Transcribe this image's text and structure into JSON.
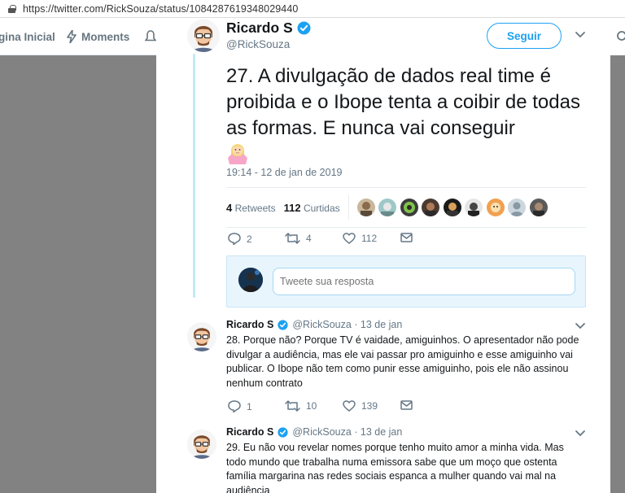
{
  "browser": {
    "url": "https://twitter.com/RickSouza/status/1084287619348029440"
  },
  "nav": {
    "home": "gina Inicial",
    "moments": "Moments"
  },
  "tweet": {
    "name": "Ricardo S",
    "handle": "@RickSouza",
    "follow_label": "Seguir",
    "text": "27. A divulgação de dados real time é proibida e o Ibope tenta a coibir de todas as formas. E nunca vai conseguir",
    "emoji": "woman-shrugging",
    "timestamp": "19:14 - 12 de jan de 2019",
    "retweets_count": "4",
    "retweets_label": "Retweets",
    "likes_count": "112",
    "likes_label": "Curtidas",
    "reply_count": "2",
    "retweet_action_count": "4",
    "like_action_count": "112",
    "reply_placeholder": "Tweete sua resposta"
  },
  "replies": [
    {
      "name": "Ricardo S",
      "meta": "@RickSouza · 13 de jan",
      "text": "28. Porque não? Porque TV é vaidade, amiguinhos. O apresentador não pode divulgar a audiência, mas ele vai passar pro amiguinho e esse amiguinho vai publicar. O Ibope não tem como punir esse amiguinho, pois ele não assinou nenhum contrato",
      "reply_count": "1",
      "retweet_count": "10",
      "like_count": "139"
    },
    {
      "name": "Ricardo S",
      "meta": "@RickSouza · 13 de jan",
      "text": "29. Eu não vou revelar nomes porque tenho muito amor a minha vida. Mas todo mundo que trabalha numa emissora sabe que um moço que ostenta família margarina nas redes sociais espanca a mulher quando vai mal na audiência"
    }
  ],
  "colors": {
    "accent": "#1da1f2",
    "verified": "#1da1f2",
    "overlay": "#828282",
    "secondary_text": "#657786"
  }
}
